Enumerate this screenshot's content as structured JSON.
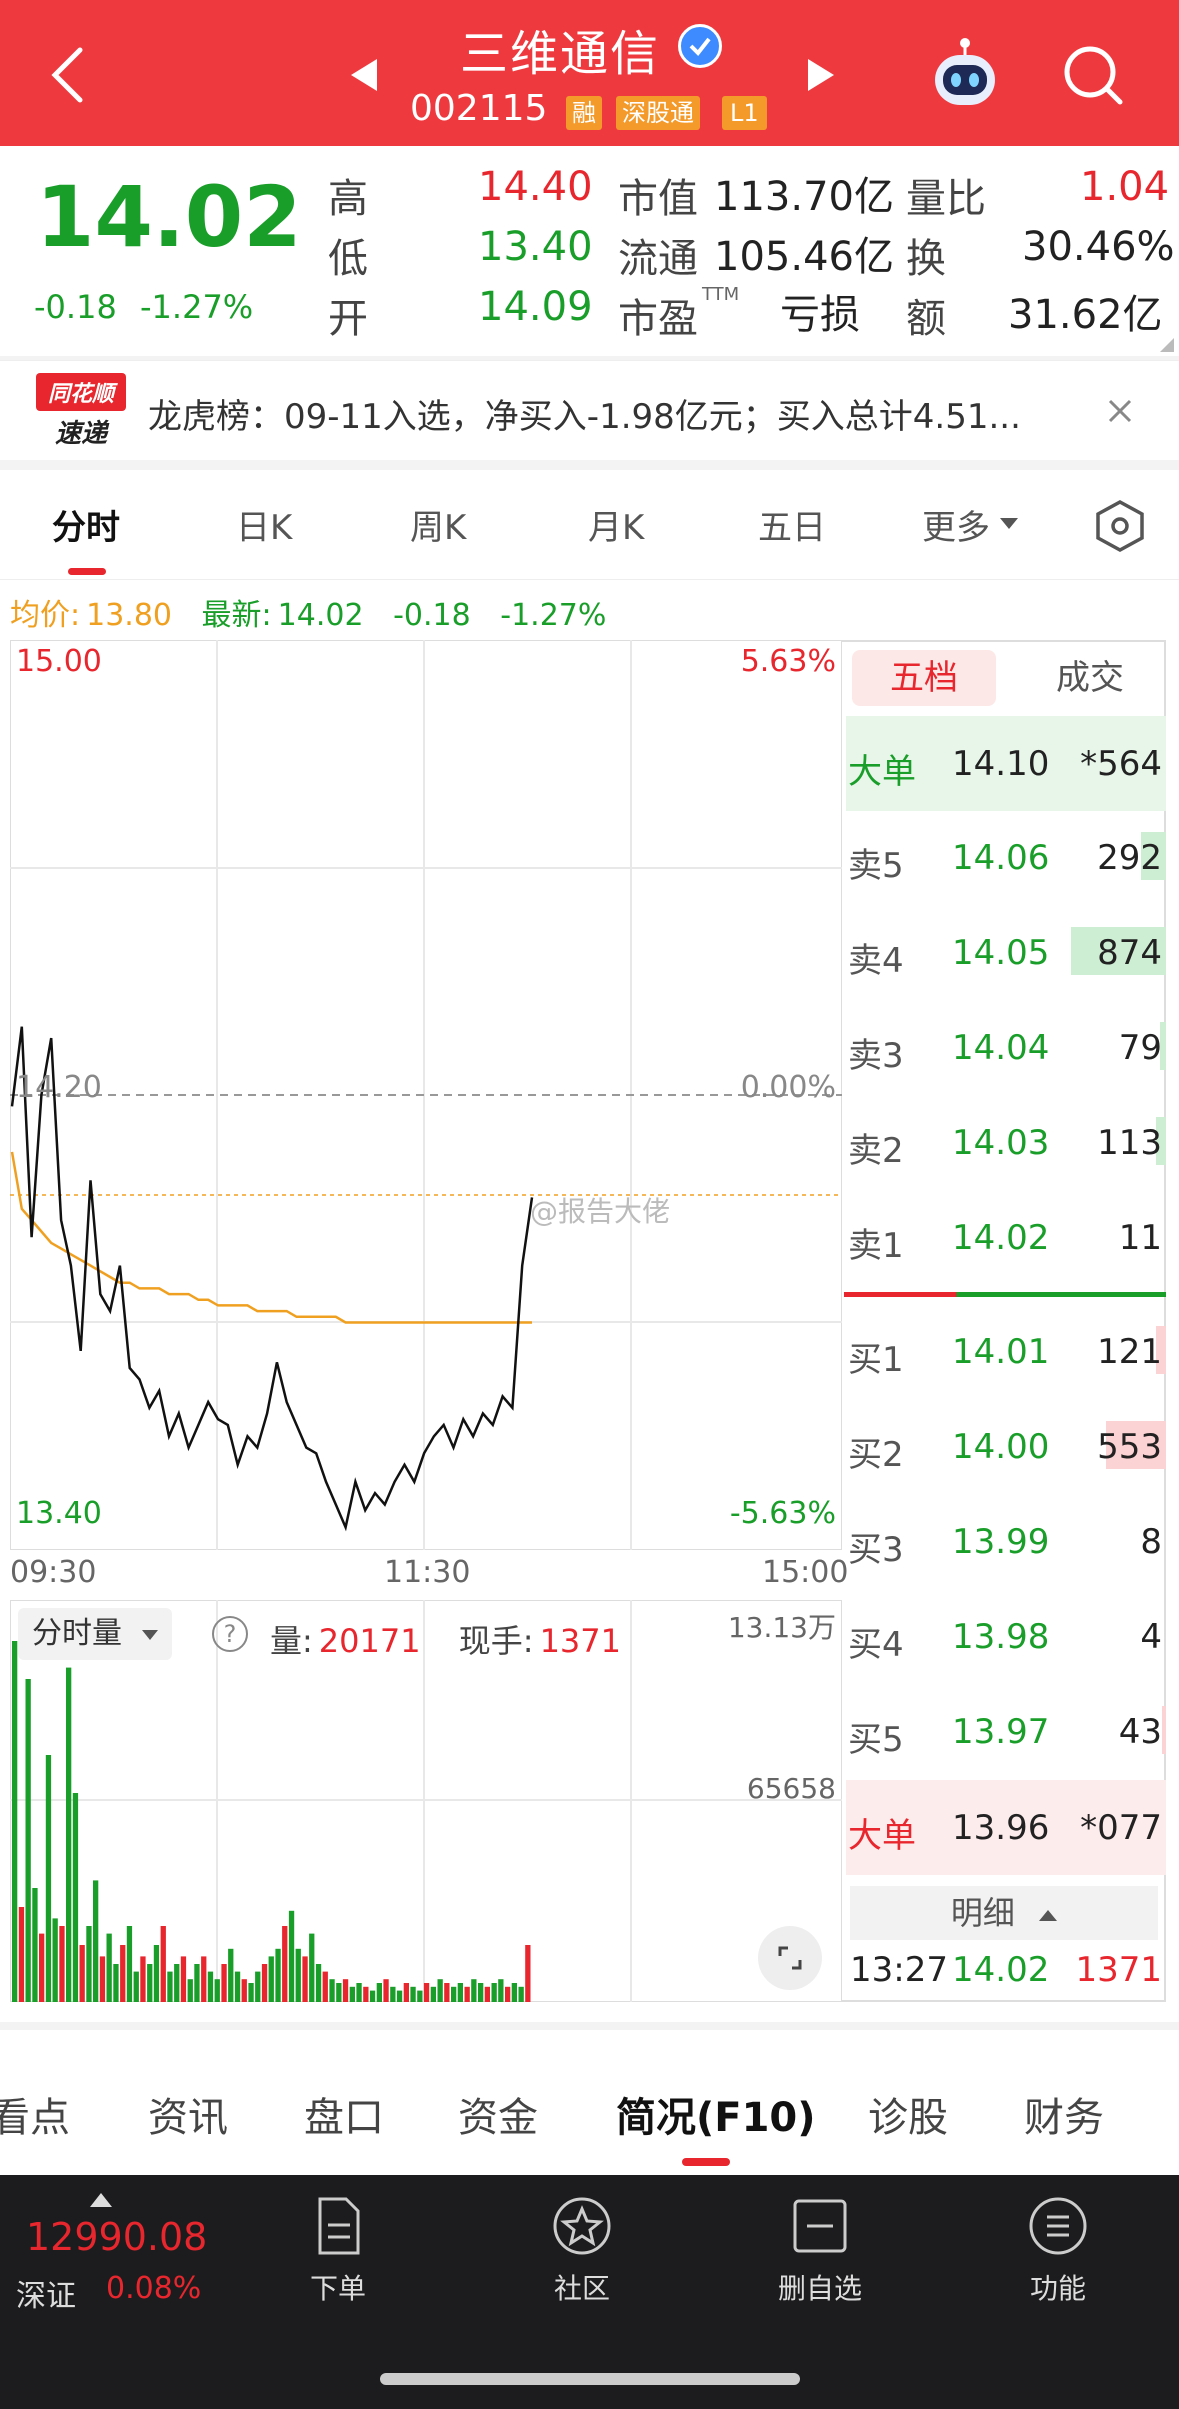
{
  "header": {
    "stock_name": "三维通信",
    "stock_code": "002115",
    "badges": [
      "融",
      "深股通",
      "L1"
    ]
  },
  "quote": {
    "price": "14.02",
    "change": "-0.18",
    "change_pct": "-1.27%",
    "high_label": "高",
    "high_value": "14.40",
    "low_label": "低",
    "low_value": "13.40",
    "open_label": "开",
    "open_value": "14.09",
    "mktcap_label": "市值",
    "mktcap_value": "113.70亿",
    "float_label": "流通",
    "float_value": "105.46亿",
    "pe_label": "市盈",
    "pe_sup": "TTM",
    "pe_value": "亏损",
    "vol_ratio_label": "量比",
    "vol_ratio_value": "1.04",
    "turnover_label": "换",
    "turnover_value": "30.46%",
    "amount_label": "额",
    "amount_value": "31.62亿"
  },
  "news": {
    "brand_line1": "同花顺",
    "brand_line2": "速递",
    "text": "龙虎榜：09-11入选，净买入-1.98亿元；买入总计4.51..."
  },
  "chart_tabs": [
    "分时",
    "日K",
    "周K",
    "月K",
    "五日",
    "更多"
  ],
  "indicator": {
    "avg_label": "均价:",
    "avg_value": "13.80",
    "latest_label": "最新:",
    "latest_value": "14.02",
    "change": "-0.18",
    "change_pct": "-1.27%"
  },
  "chart_data": {
    "type": "line",
    "y_top_label": "15.00",
    "y_mid_label": "14.20",
    "y_bottom_label": "13.40",
    "pct_top_label": "5.63%",
    "pct_mid_label": "0.00%",
    "pct_bottom_label": "-5.63%",
    "x_labels": [
      "09:30",
      "11:30",
      "15:00"
    ],
    "ylim": [
      13.4,
      15.0
    ],
    "prev_close": 14.2,
    "series": [
      {
        "name": "price",
        "values": [
          14.18,
          14.32,
          13.95,
          14.2,
          14.3,
          13.98,
          13.9,
          13.75,
          14.05,
          13.85,
          13.82,
          13.9,
          13.72,
          13.7,
          13.65,
          13.68,
          13.6,
          13.64,
          13.58,
          13.62,
          13.66,
          13.63,
          13.62,
          13.55,
          13.6,
          13.58,
          13.64,
          13.73,
          13.66,
          13.62,
          13.58,
          13.57,
          13.52,
          13.48,
          13.44,
          13.52,
          13.47,
          13.5,
          13.48,
          13.52,
          13.55,
          13.52,
          13.57,
          13.6,
          13.62,
          13.58,
          13.63,
          13.6,
          13.64,
          13.62,
          13.67,
          13.65,
          13.9,
          14.02
        ]
      },
      {
        "name": "avg",
        "values": [
          14.1,
          14.0,
          13.98,
          13.96,
          13.94,
          13.93,
          13.92,
          13.91,
          13.9,
          13.89,
          13.88,
          13.87,
          13.87,
          13.86,
          13.86,
          13.86,
          13.85,
          13.85,
          13.85,
          13.84,
          13.84,
          13.83,
          13.83,
          13.83,
          13.83,
          13.82,
          13.82,
          13.82,
          13.82,
          13.81,
          13.81,
          13.81,
          13.81,
          13.81,
          13.8,
          13.8,
          13.8,
          13.8,
          13.8,
          13.8,
          13.8,
          13.8,
          13.8,
          13.8,
          13.8,
          13.8,
          13.8,
          13.8,
          13.8,
          13.8,
          13.8,
          13.8,
          13.8,
          13.8
        ]
      }
    ]
  },
  "volume": {
    "selector_label": "分时量",
    "vol_label": "量:",
    "vol_value": "20171",
    "hand_label": "现手:",
    "hand_value": "1371",
    "max_label": "13.13万",
    "mid_label": "65658",
    "bars": [
      0.95,
      0.25,
      0.85,
      0.3,
      0.18,
      0.65,
      0.22,
      0.2,
      0.88,
      0.55,
      0.15,
      0.2,
      0.32,
      0.12,
      0.18,
      0.1,
      0.15,
      0.2,
      0.08,
      0.12,
      0.1,
      0.15,
      0.2,
      0.08,
      0.1,
      0.12,
      0.06,
      0.1,
      0.12,
      0.08,
      0.06,
      0.1,
      0.14,
      0.08,
      0.06,
      0.05,
      0.08,
      0.1,
      0.12,
      0.14,
      0.2,
      0.24,
      0.14,
      0.12,
      0.18,
      0.1,
      0.08,
      0.06,
      0.05,
      0.06,
      0.04,
      0.05,
      0.04,
      0.03,
      0.05,
      0.06,
      0.04,
      0.03,
      0.05,
      0.04,
      0.03,
      0.05,
      0.04,
      0.06,
      0.05,
      0.04,
      0.05,
      0.04,
      0.06,
      0.05,
      0.04,
      0.05,
      0.06,
      0.04,
      0.05,
      0.04,
      0.15
    ]
  },
  "market": {
    "tab_five": "五档",
    "tab_trades": "成交",
    "big_sell_label": "大单",
    "big_sell_price": "14.10",
    "big_sell_vol": "*564",
    "sells": [
      {
        "label": "卖5",
        "price": "14.06",
        "vol": "292",
        "bar": 0.25
      },
      {
        "label": "卖4",
        "price": "14.05",
        "vol": "874",
        "bar": 0.95
      },
      {
        "label": "卖3",
        "price": "14.04",
        "vol": "79",
        "bar": 0.06
      },
      {
        "label": "卖2",
        "price": "14.03",
        "vol": "113",
        "bar": 0.1
      },
      {
        "label": "卖1",
        "price": "14.02",
        "vol": "11",
        "bar": 0.0
      }
    ],
    "buys": [
      {
        "label": "买1",
        "price": "14.01",
        "vol": "121",
        "bar": 0.1
      },
      {
        "label": "买2",
        "price": "14.00",
        "vol": "553",
        "bar": 0.6
      },
      {
        "label": "买3",
        "price": "13.99",
        "vol": "8",
        "bar": 0.0
      },
      {
        "label": "买4",
        "price": "13.98",
        "vol": "4",
        "bar": 0.0
      },
      {
        "label": "买5",
        "price": "13.97",
        "vol": "43",
        "bar": 0.04
      }
    ],
    "big_buy_label": "大单",
    "big_buy_price": "13.96",
    "big_buy_vol": "*077",
    "detail_label": "明细",
    "last_time": "13:27",
    "last_price": "14.02",
    "last_vol": "1371"
  },
  "bottom_tabs": [
    "看点",
    "资讯",
    "盘口",
    "资金",
    "简况(F10)",
    "诊股",
    "财务"
  ],
  "bottom_nav": {
    "index_value": "12990.08",
    "index_name": "深证",
    "index_pct": "0.08%",
    "items": [
      "下单",
      "社区",
      "删自选",
      "功能"
    ]
  },
  "watermark": "@报告大佬",
  "colors": {
    "red": "#e8262d",
    "green": "#1a9e2a",
    "header": "#ee3a3f",
    "avg_line": "#f0a020"
  }
}
